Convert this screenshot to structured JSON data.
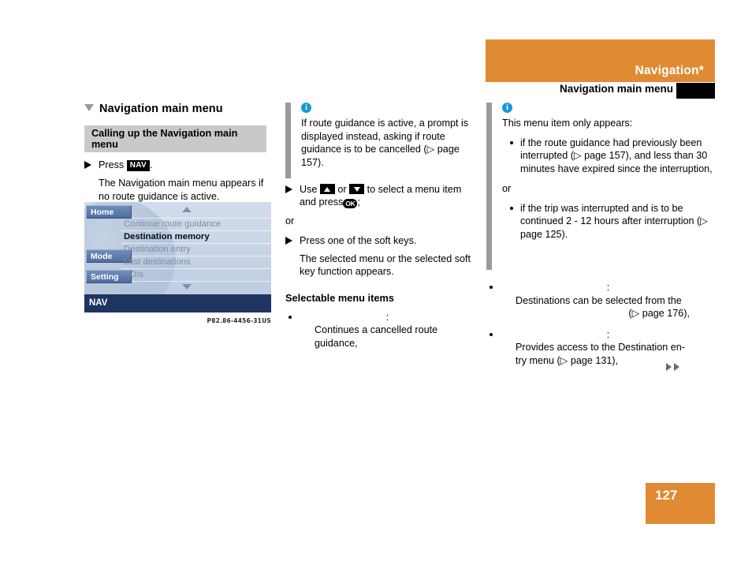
{
  "header": {
    "title": "Navigation*",
    "subtitle": "Navigation main menu",
    "band_color": "#e08b33"
  },
  "page_number": "127",
  "left_column": {
    "section_title": "Navigation main menu",
    "subhead": "Calling up the Navigation main menu",
    "step": {
      "prefix": "Press",
      "keycap": "NAV",
      "suffix": "."
    },
    "result_text": "The Navigation main menu appears if no route guidance is active.",
    "figure": {
      "softkeys": [
        {
          "label": "Home"
        },
        {
          "label": "Mode"
        },
        {
          "label": "Setting"
        }
      ],
      "menu_items": [
        {
          "label": "Continue route guidance",
          "selected": false
        },
        {
          "label": "Destination memory",
          "selected": true
        },
        {
          "label": "Destination entry",
          "selected": false
        },
        {
          "label": "Last destinations",
          "selected": false
        },
        {
          "label": "POIs",
          "selected": false
        }
      ],
      "status_bar": "NAV",
      "caption": "P82.86-4456-31US"
    }
  },
  "middle_column": {
    "note": {
      "icon": "info-icon",
      "text": "If route guidance is active, a prompt is displayed instead, asking if route guidance is to be cancelled (▷ page 157)."
    },
    "step_select": {
      "part1": "Use",
      "key_up": "up-arrow-key",
      "part2": "or",
      "key_down": "down-arrow-key",
      "part3": "to select a menu item and press",
      "key_ok": "OK",
      "part4": ";"
    },
    "or": "or",
    "step_softkey": "Press one of the soft keys.",
    "step_softkey_result": "The selected menu or the selected soft key function appears.",
    "selectable_heading": "Selectable menu items",
    "items": [
      {
        "label": "",
        "colon": ":",
        "description": "Continues a cancelled route guidance,"
      }
    ]
  },
  "right_column": {
    "note": {
      "icon": "info-icon",
      "text": "This menu item only appears:",
      "bullets": [
        "if the route guidance had previously been interrupted (▷ page 157), and less than 30 minutes have expired since the interruption,",
        "if the trip was interrupted and is to be continued 2 - 12 hours after interruption (▷ page 125)."
      ],
      "or": "or"
    },
    "items": [
      {
        "label": "",
        "colon": ":",
        "description_line1": "Destinations can be selected from the",
        "description_line2": "(▷ page 176),"
      },
      {
        "label": "",
        "colon": ":",
        "description_line1": "Provides access to the Destination en-",
        "description_line2": "try menu (▷ page 131),"
      }
    ],
    "continuation": "▷▷"
  }
}
